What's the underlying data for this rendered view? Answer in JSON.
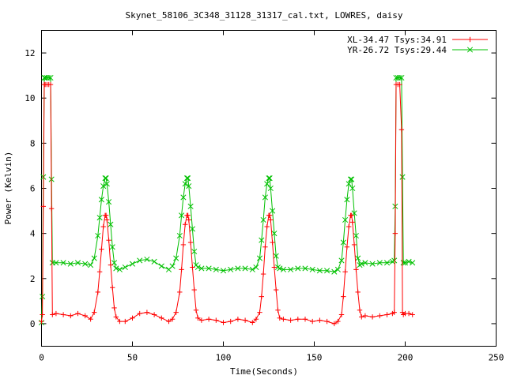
{
  "chart_data": {
    "type": "line",
    "title": "Skynet_58106_3C348_31128_31317_cal.txt, LOWRES, daisy",
    "xlabel": "Time(Seconds)",
    "ylabel": "Power (Kelvin)",
    "xlim": [
      0,
      250
    ],
    "ylim": [
      -1,
      13
    ],
    "x_ticks": [
      "0",
      "50",
      "100",
      "150",
      "200",
      "250"
    ],
    "y_ticks": [
      "0",
      "2",
      "4",
      "6",
      "8",
      "10",
      "12"
    ],
    "grid": false,
    "legend_position": "top-right",
    "series": [
      {
        "name": "XL-34.47 Tsys:34.91",
        "color": "#ff0000",
        "marker": "plus",
        "x": [
          0,
          0.5,
          1,
          1.5,
          2,
          3,
          4,
          5,
          5.5,
          6,
          8,
          12,
          16,
          20,
          24,
          27,
          29,
          31,
          32,
          33,
          34,
          35,
          35.5,
          36,
          37,
          38,
          39,
          40,
          41,
          43,
          46,
          50,
          54,
          58,
          62,
          66,
          70,
          72,
          74,
          76,
          77,
          78,
          79,
          80,
          80.5,
          81,
          82,
          83,
          84,
          85,
          86,
          88,
          92,
          96,
          100,
          104,
          108,
          112,
          116,
          118,
          120,
          121,
          122,
          123,
          124,
          125,
          125.5,
          126,
          127,
          128,
          129,
          130,
          131,
          133,
          137,
          141,
          145,
          149,
          153,
          157,
          161,
          163,
          165,
          166,
          167,
          168,
          169,
          170,
          170.5,
          171,
          172,
          173,
          174,
          175,
          176,
          178,
          182,
          186,
          190,
          193,
          194,
          194.5,
          195,
          196,
          197,
          198,
          198.5,
          199,
          200,
          202,
          204
        ],
        "y": [
          0.1,
          0.4,
          5.2,
          10.6,
          10.6,
          10.6,
          10.6,
          10.6,
          5.1,
          0.4,
          0.45,
          0.4,
          0.35,
          0.45,
          0.35,
          0.2,
          0.5,
          1.4,
          2.3,
          3.3,
          4.3,
          4.8,
          4.8,
          4.6,
          3.7,
          2.6,
          1.6,
          0.7,
          0.3,
          0.1,
          0.1,
          0.25,
          0.45,
          0.5,
          0.4,
          0.25,
          0.1,
          0.2,
          0.5,
          1.4,
          2.4,
          3.5,
          4.4,
          4.8,
          4.8,
          4.6,
          3.6,
          2.5,
          1.5,
          0.6,
          0.25,
          0.15,
          0.2,
          0.15,
          0.05,
          0.1,
          0.2,
          0.15,
          0.05,
          0.2,
          0.5,
          1.2,
          2.2,
          3.4,
          4.3,
          4.8,
          4.8,
          4.6,
          3.6,
          2.5,
          1.5,
          0.6,
          0.25,
          0.2,
          0.15,
          0.2,
          0.2,
          0.1,
          0.15,
          0.1,
          0.0,
          0.1,
          0.4,
          1.2,
          2.3,
          3.4,
          4.3,
          4.8,
          4.8,
          4.5,
          3.5,
          2.4,
          1.4,
          0.6,
          0.3,
          0.35,
          0.3,
          0.35,
          0.4,
          0.45,
          0.5,
          4.0,
          10.6,
          10.6,
          10.6,
          8.6,
          0.5,
          0.4,
          0.45,
          0.45,
          0.4
        ]
      },
      {
        "name": "YR-26.72 Tsys:29.44",
        "color": "#00c000",
        "marker": "cross",
        "x": [
          0,
          0.5,
          1,
          1.5,
          2,
          3,
          4,
          5,
          5.5,
          6,
          8,
          12,
          16,
          20,
          24,
          27,
          29,
          31,
          32,
          33,
          34,
          35,
          35.5,
          36,
          37,
          38,
          39,
          40,
          41,
          43,
          46,
          50,
          54,
          58,
          62,
          66,
          70,
          72,
          74,
          76,
          77,
          78,
          79,
          80,
          80.5,
          81,
          82,
          83,
          84,
          85,
          86,
          88,
          92,
          96,
          100,
          104,
          108,
          112,
          116,
          118,
          120,
          121,
          122,
          123,
          124,
          125,
          125.5,
          126,
          127,
          128,
          129,
          130,
          131,
          133,
          137,
          141,
          145,
          149,
          153,
          157,
          161,
          163,
          165,
          166,
          167,
          168,
          169,
          170,
          170.5,
          171,
          172,
          173,
          174,
          175,
          176,
          178,
          182,
          186,
          190,
          193,
          194,
          194.5,
          195,
          196,
          197,
          198,
          198.5,
          199,
          200,
          202,
          204
        ],
        "y": [
          0.05,
          1.2,
          6.5,
          10.9,
          10.9,
          10.9,
          10.9,
          10.9,
          6.4,
          2.7,
          2.7,
          2.7,
          2.65,
          2.7,
          2.65,
          2.6,
          2.9,
          3.9,
          4.7,
          5.5,
          6.1,
          6.45,
          6.45,
          6.2,
          5.4,
          4.4,
          3.4,
          2.7,
          2.45,
          2.4,
          2.5,
          2.65,
          2.8,
          2.85,
          2.75,
          2.55,
          2.4,
          2.55,
          2.9,
          3.9,
          4.8,
          5.6,
          6.2,
          6.45,
          6.45,
          6.1,
          5.2,
          4.2,
          3.2,
          2.6,
          2.5,
          2.45,
          2.45,
          2.4,
          2.35,
          2.4,
          2.45,
          2.45,
          2.4,
          2.5,
          2.9,
          3.7,
          4.6,
          5.6,
          6.2,
          6.45,
          6.45,
          6.0,
          5.0,
          4.0,
          3.0,
          2.5,
          2.45,
          2.4,
          2.4,
          2.45,
          2.45,
          2.4,
          2.35,
          2.35,
          2.3,
          2.4,
          2.8,
          3.6,
          4.6,
          5.5,
          6.2,
          6.4,
          6.4,
          6.0,
          4.9,
          3.9,
          2.9,
          2.6,
          2.65,
          2.7,
          2.65,
          2.7,
          2.7,
          2.75,
          2.8,
          5.2,
          10.9,
          10.9,
          10.9,
          10.9,
          6.5,
          2.7,
          2.7,
          2.75,
          2.7
        ]
      }
    ]
  }
}
